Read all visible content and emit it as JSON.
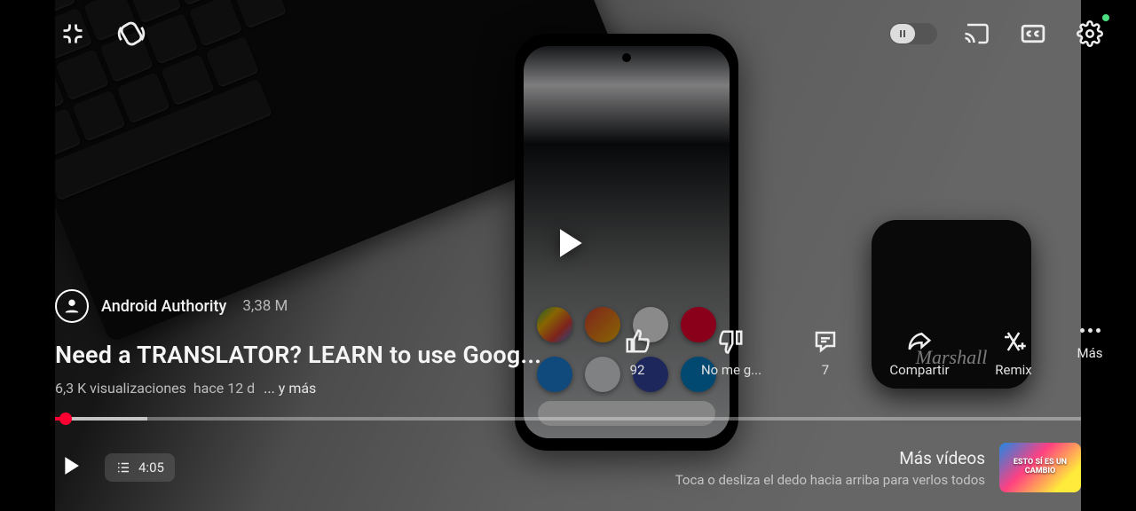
{
  "channel": {
    "name": "Android Authority",
    "subs": "3,38 M"
  },
  "video": {
    "title": "Need a TRANSLATOR? LEARN to use Goog...",
    "views": "6,3 K visualizaciones",
    "age": "hace 12 d",
    "more_label": "... y más",
    "duration": "4:05"
  },
  "actions": {
    "like": "92",
    "dislike": "No me g...",
    "comments": "7",
    "share": "Compartir",
    "remix": "Remix",
    "more": "Más"
  },
  "next": {
    "title": "Más vídeos",
    "hint": "Toca o desliza el dedo hacia arriba para verlos todos",
    "thumb_text": "ESTO SÍ ES UN CAMBIO"
  },
  "earbuds_brand": "Marshall"
}
